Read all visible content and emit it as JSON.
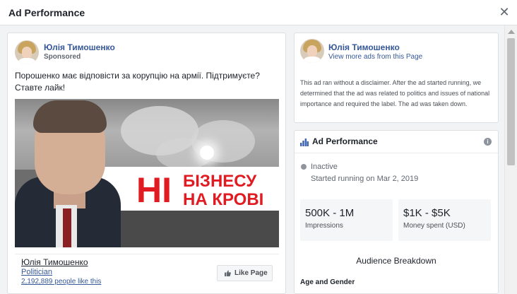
{
  "modal": {
    "title": "Ad Performance",
    "close_glyph": "✕"
  },
  "ad_preview": {
    "page_name": "Юлія Тимошенко",
    "sponsored_label": "Sponsored",
    "body_text": "Порошенко має відповісти за корупцію на армії. Підтримуєте? Ставте лайк!",
    "image_text": {
      "big_letters": "НІ",
      "line1": "БІЗНЕСУ",
      "line2": "НА КРОВІ",
      "text_color": "#e01b22"
    },
    "footer": {
      "page_name": "Юлія Тимошенко",
      "category": "Politician",
      "likes_text": "2,192,889 people like this",
      "like_button_label": "Like Page"
    }
  },
  "page_info": {
    "page_name": "Юлія Тимошенко",
    "view_more_link": "View more ads from this Page",
    "disclaimer": "This ad ran without a disclaimer. After the ad started running, we determined that the ad was related to politics and issues of national importance and required the label. The ad was taken down."
  },
  "performance": {
    "title": "Ad Performance",
    "info_glyph": "i",
    "status": "Inactive",
    "started": "Started running on Mar 2, 2019",
    "metrics": [
      {
        "value": "500K - 1M",
        "label": "Impressions"
      },
      {
        "value": "$1K - $5K",
        "label": "Money spent (USD)"
      }
    ],
    "audience_title": "Audience Breakdown",
    "age_gender_label": "Age and Gender"
  },
  "colors": {
    "link_blue": "#365899",
    "background_gray": "#f2f3f5",
    "chart_icon_blue": "#4267b2"
  },
  "icons": {
    "close": "close-icon",
    "like": "thumbs-up-icon",
    "performance": "bar-chart-icon",
    "info": "info-icon"
  }
}
